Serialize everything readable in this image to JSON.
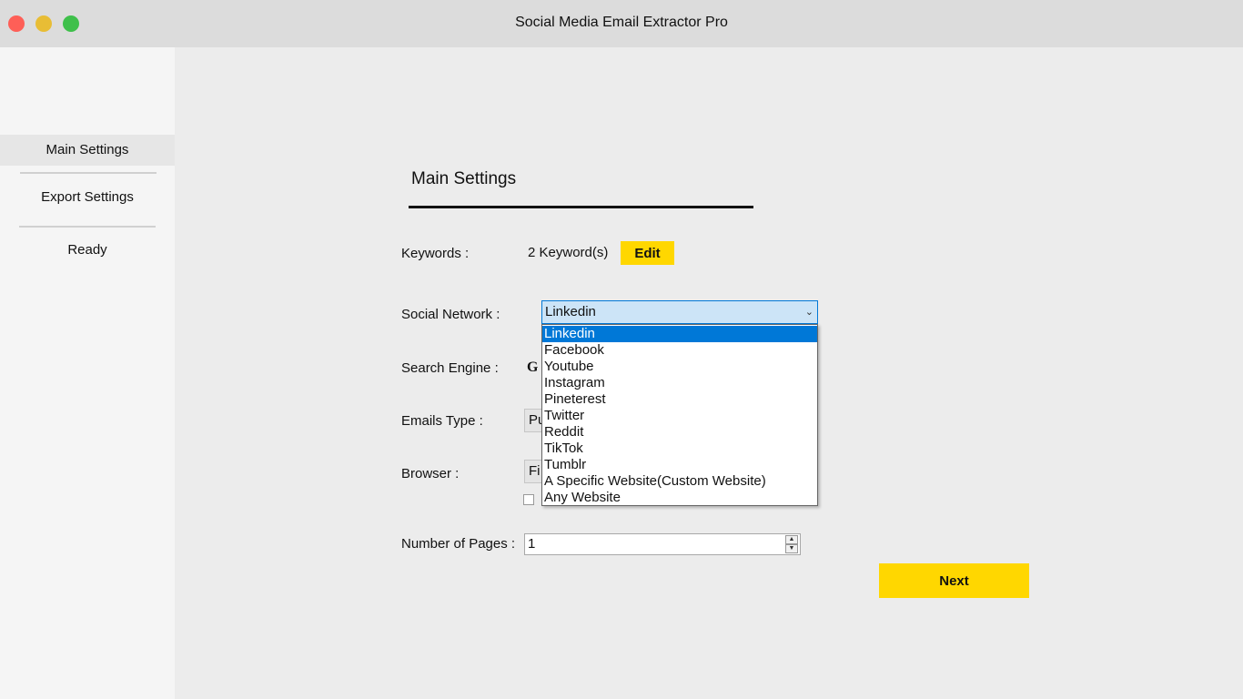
{
  "window": {
    "title": "Social Media Email Extractor Pro",
    "traffic_lights": {
      "close": "#fe5f57",
      "minimize": "#e8bd35",
      "maximize": "#3fc04b"
    }
  },
  "sidebar": {
    "items": [
      {
        "label": "Main Settings",
        "active": true
      },
      {
        "label": "Export Settings",
        "active": false
      },
      {
        "label": "Ready",
        "active": false
      }
    ]
  },
  "main": {
    "section_title": "Main Settings",
    "keywords": {
      "label": "Keywords :",
      "value": "2 Keyword(s)",
      "edit_label": "Edit"
    },
    "social_network": {
      "label": "Social Network :",
      "selected": "Linkedin",
      "arrow_icon": "chevron-down-icon",
      "options": [
        "Linkedin",
        "Facebook",
        "Youtube",
        "Instagram",
        "Pineterest",
        "Twitter",
        "Reddit",
        "TikTok",
        "Tumblr",
        "A Specific Website(Custom Website)",
        "Any Website"
      ]
    },
    "search_engine": {
      "label": "Search Engine :",
      "value_visible": "G"
    },
    "emails_type": {
      "label": "Emails Type :",
      "value_visible": "Pu"
    },
    "browser": {
      "label": "Browser :",
      "value_visible": "Fi"
    },
    "pages": {
      "label": "Number of Pages :",
      "value": "1"
    },
    "next_label": "Next",
    "accent": "#ffd700",
    "highlight": "#0078d7"
  }
}
